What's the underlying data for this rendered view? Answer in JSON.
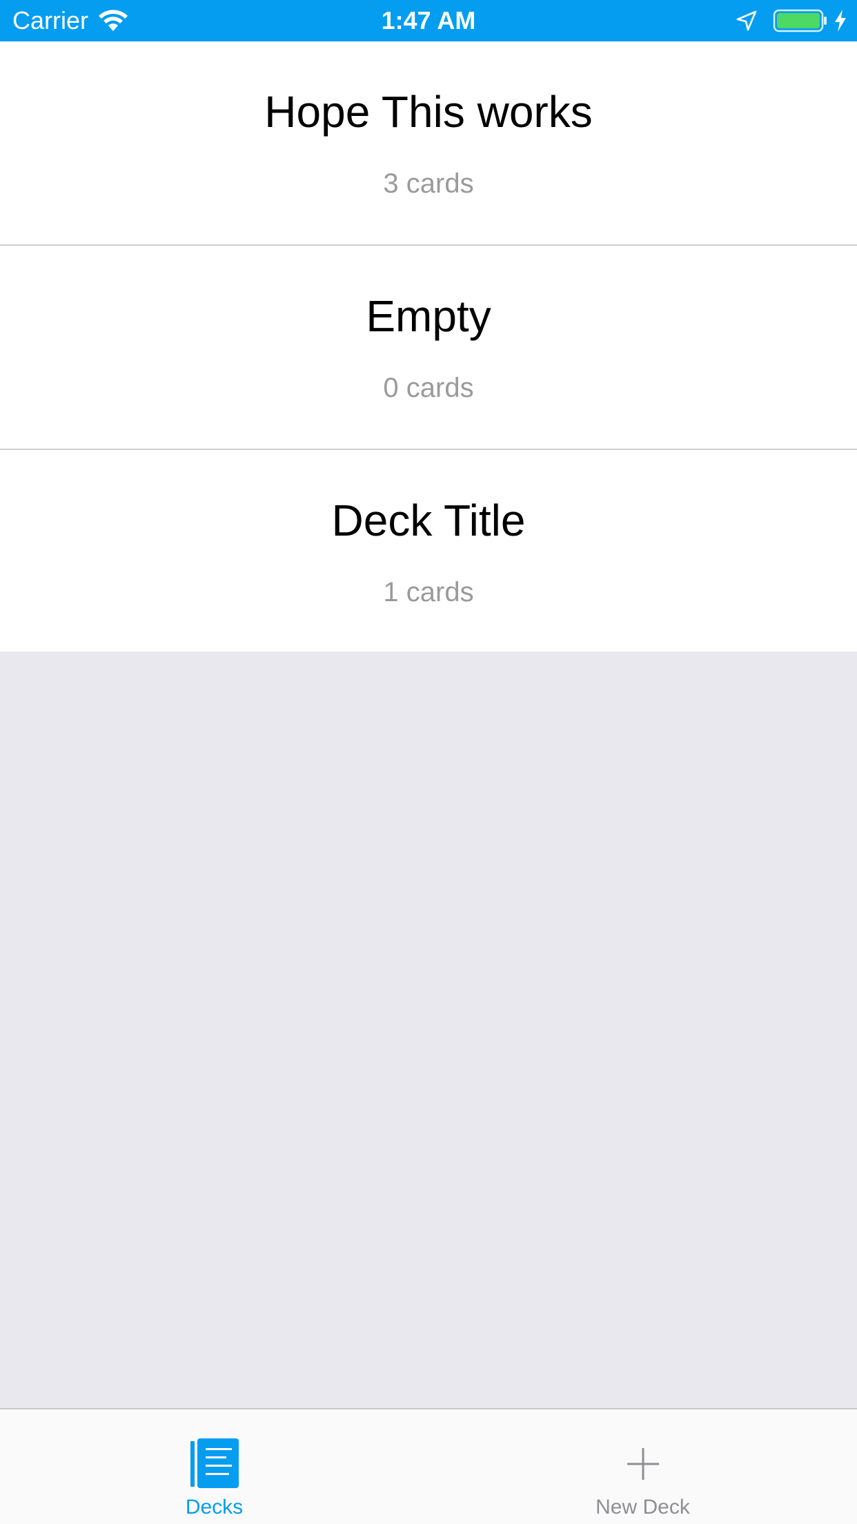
{
  "status_bar": {
    "carrier": "Carrier",
    "time": "1:47 AM",
    "background_color": "#049df0",
    "icons": [
      "wifi-icon",
      "location-arrow-icon",
      "battery-icon",
      "charging-bolt-icon"
    ],
    "battery_level": 1.0
  },
  "decks": [
    {
      "title": "Hope This works",
      "count": "3 cards"
    },
    {
      "title": "Empty",
      "count": "0 cards"
    },
    {
      "title": "Deck Title",
      "count": "1 cards"
    }
  ],
  "tab_bar": {
    "tabs": [
      {
        "label": "Decks",
        "icon": "decks-list-icon",
        "active": true
      },
      {
        "label": "New Deck",
        "icon": "plus-icon",
        "active": false
      }
    ],
    "active_color": "#049df0",
    "inactive_color": "#8e8e93"
  }
}
